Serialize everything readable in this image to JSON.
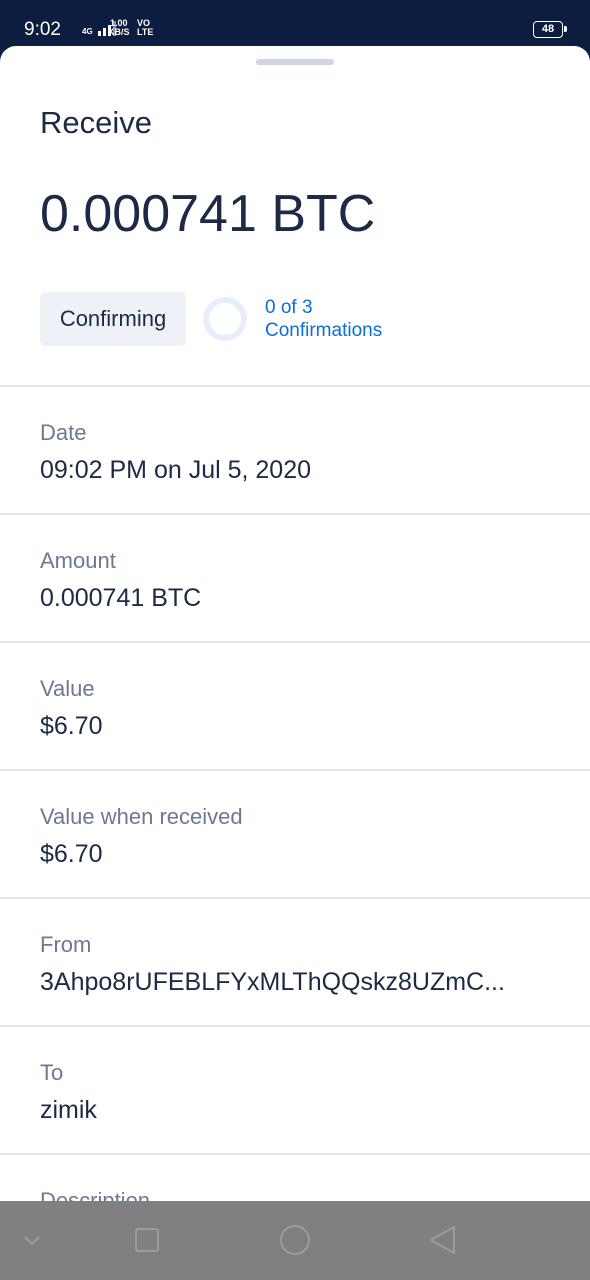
{
  "status_bar": {
    "time": "9:02",
    "network": "4G",
    "speed_top": "1.00",
    "speed_bottom": "KB/S",
    "volte_top": "VO",
    "volte_bottom": "LTE",
    "battery": "48"
  },
  "header": {
    "title": "Receive",
    "amount": "0.000741 BTC"
  },
  "confirmation": {
    "status": "Confirming",
    "text_line1": "0 of 3",
    "text_line2": "Confirmations",
    "progress": 0
  },
  "details": [
    {
      "label": "Date",
      "value": "09:02 PM on Jul 5, 2020"
    },
    {
      "label": "Amount",
      "value": "0.000741 BTC"
    },
    {
      "label": "Value",
      "value": "$6.70"
    },
    {
      "label": "Value when received",
      "value": "$6.70"
    },
    {
      "label": "From",
      "value": "3Ahpo8rUFEBLFYxMLThQQskz8UZmC..."
    },
    {
      "label": "To",
      "value": "zimik"
    },
    {
      "label": "Description",
      "value": ""
    }
  ],
  "colors": {
    "accent": "#0a6fd6",
    "text": "#1c2a45",
    "muted": "#6c7a90"
  }
}
